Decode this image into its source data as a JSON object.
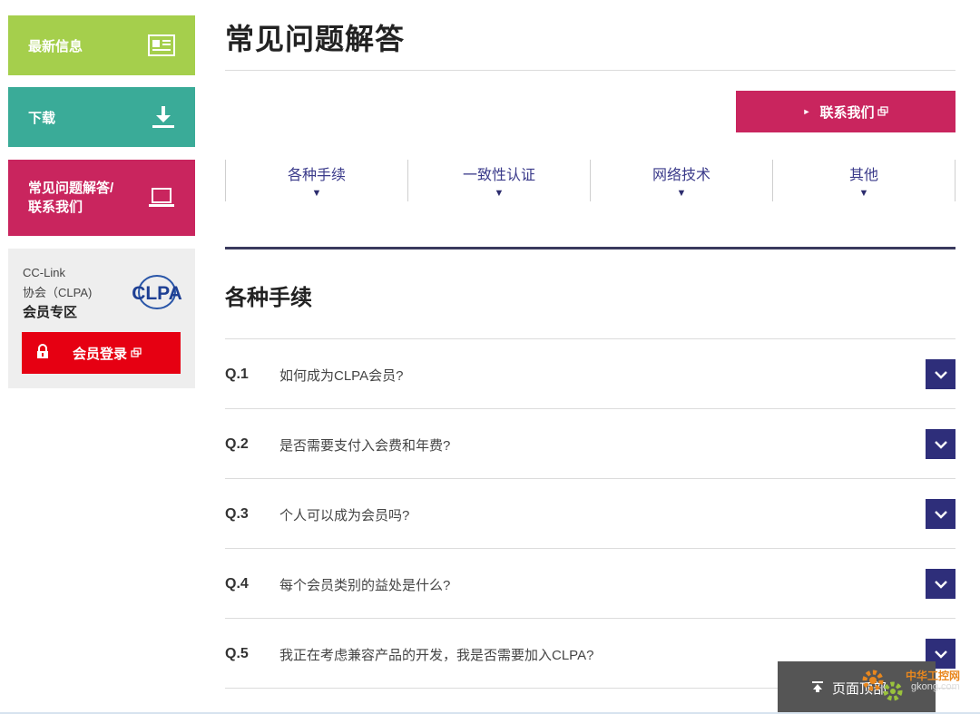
{
  "sidebar": {
    "news_label": "最新信息",
    "download_label": "下载",
    "faq_label": "常见问题解答/\n联系我们",
    "member": {
      "line1": "CC-Link",
      "line2": "协会（CLPA)",
      "line3": "会员专区",
      "logo_text": "CLPA",
      "login_label": "会员登录"
    }
  },
  "main": {
    "title": "常见问题解答",
    "contact_label": "联系我们",
    "categories": [
      {
        "label": "各种手续"
      },
      {
        "label": "一致性认证"
      },
      {
        "label": "网络技术"
      },
      {
        "label": "其他"
      }
    ],
    "section_title": "各种手续",
    "faqs": [
      {
        "num": "Q.1",
        "question": "如何成为CLPA会员?"
      },
      {
        "num": "Q.2",
        "question": "是否需要支付入会费和年费?"
      },
      {
        "num": "Q.3",
        "question": "个人可以成为会员吗?"
      },
      {
        "num": "Q.4",
        "question": "每个会员类别的益处是什么?"
      },
      {
        "num": "Q.5",
        "question": "我正在考虑兼容产品的开发，我是否需要加入CLPA?"
      }
    ]
  },
  "back_to_top": {
    "label": "页面顶部"
  },
  "watermark": {
    "line1": "中华工控网",
    "line2": "gkong.com"
  },
  "colors": {
    "news": "#a5cf4c",
    "download": "#3aab98",
    "faq": "#c9255e",
    "login": "#e60012",
    "navy": "#2e2e7a"
  },
  "icons": {
    "news": "newspaper-icon",
    "download": "download-icon",
    "faq": "laptop-icon",
    "lock": "lock-icon",
    "external": "external-link-icon",
    "toggle": "chevron-down-icon",
    "up": "arrow-up-icon"
  }
}
